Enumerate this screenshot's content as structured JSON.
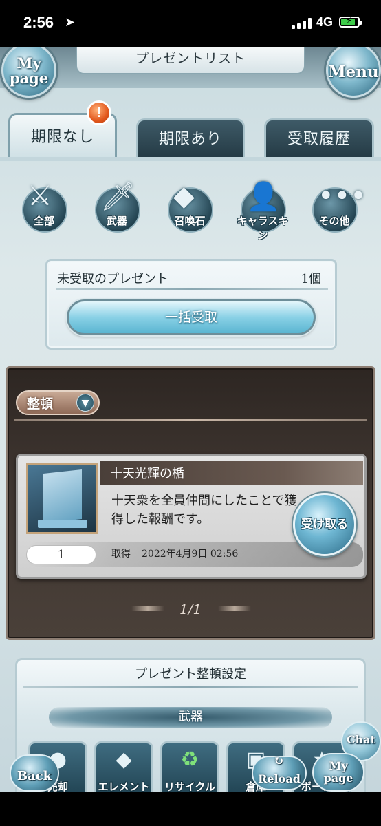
{
  "status_bar": {
    "time": "2:56",
    "network": "4G",
    "location_icon": "arrow-icon",
    "battery_state": "charging"
  },
  "header": {
    "title": "プレゼントリスト",
    "mypage_top": "My\npage",
    "menu": "Menu"
  },
  "tabs": [
    {
      "label": "期限なし",
      "active": true
    },
    {
      "label": "期限あり",
      "active": false
    },
    {
      "label": "受取履歴",
      "active": false
    }
  ],
  "alert_badge": "!",
  "categories": [
    {
      "label": "全部",
      "icon": "all-icon"
    },
    {
      "label": "武器",
      "icon": "sword-icon"
    },
    {
      "label": "召喚石",
      "icon": "crystal-icon"
    },
    {
      "label": "キャラスキン",
      "icon": "character-icon"
    },
    {
      "label": "その他",
      "icon": "more-icon"
    }
  ],
  "unclaimed": {
    "label": "未受取のプレゼント",
    "count": "1個",
    "bulk_button": "一括受取"
  },
  "sort_button": "整頓",
  "item": {
    "name": "十天光輝の楯",
    "description": "十天衆を全員仲間にしたことで獲得した報酬です。",
    "quantity": "1",
    "acquired_label": "取得",
    "acquired_date": "2022年4月9日 02:56",
    "receive_button": "受け取る"
  },
  "pager": "1/1",
  "settings": {
    "title": "プレゼント整頓設定",
    "section": "武器",
    "options": [
      {
        "label": "売却",
        "icon": "coin-icon"
      },
      {
        "label": "エレメント",
        "icon": "element-icon"
      },
      {
        "label": "リサイクル",
        "icon": "recycle-icon"
      },
      {
        "label": "倉庫",
        "icon": "storage-icon"
      },
      {
        "label": "ボーナス",
        "icon": "bonus-icon"
      }
    ]
  },
  "bottom_buttons": {
    "chat": "Chat",
    "back": "Back",
    "reload": "Reload",
    "mypage": "My\npage"
  },
  "colors": {
    "accent": "#5ab5d1",
    "panel_dark": "#3e3530",
    "alert": "#e2571c"
  }
}
